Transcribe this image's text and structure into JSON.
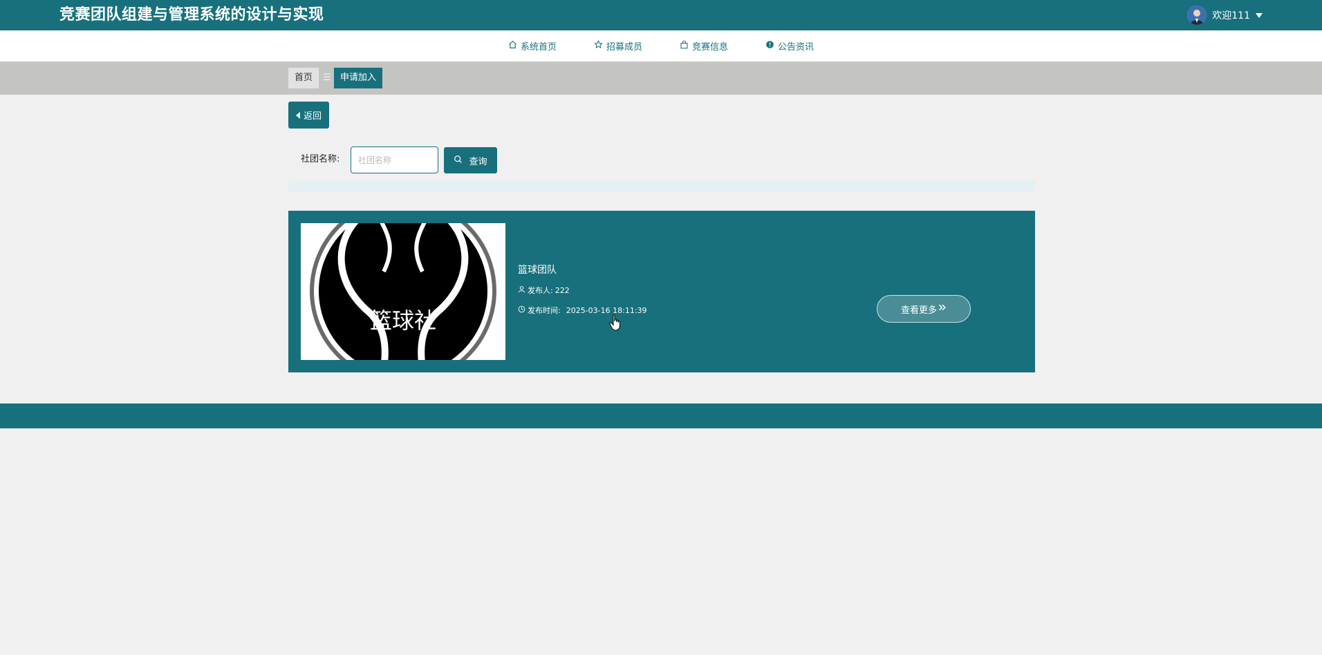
{
  "header": {
    "title": "竞赛团队组建与管理系统的设计与实现",
    "welcome": "欢迎111"
  },
  "nav": {
    "items": [
      {
        "label": "系统首页",
        "icon": "home-icon"
      },
      {
        "label": "招募成员",
        "icon": "star-icon"
      },
      {
        "label": "竞赛信息",
        "icon": "bag-icon"
      },
      {
        "label": "公告资讯",
        "icon": "info-circle-icon"
      }
    ]
  },
  "breadcrumb": {
    "home": "首页",
    "separator": "☰",
    "current": "申请加入"
  },
  "back_label": "返回",
  "search": {
    "label": "社团名称:",
    "placeholder": "社团名称",
    "value": "",
    "button_label": "查询"
  },
  "cards": [
    {
      "image_text": "篮球社",
      "title": "篮球团队",
      "publisher_label": "发布人:",
      "publisher": "222",
      "time_label": "发布时间:",
      "time": "2025-03-16 18:11:39",
      "more_label": "查看更多",
      "more_icon": "double-chevron-right-icon"
    }
  ],
  "colors": {
    "primary": "#18707c",
    "page_bg": "#f0f0f0",
    "breadcrumb_bg": "#c4c4c3"
  }
}
